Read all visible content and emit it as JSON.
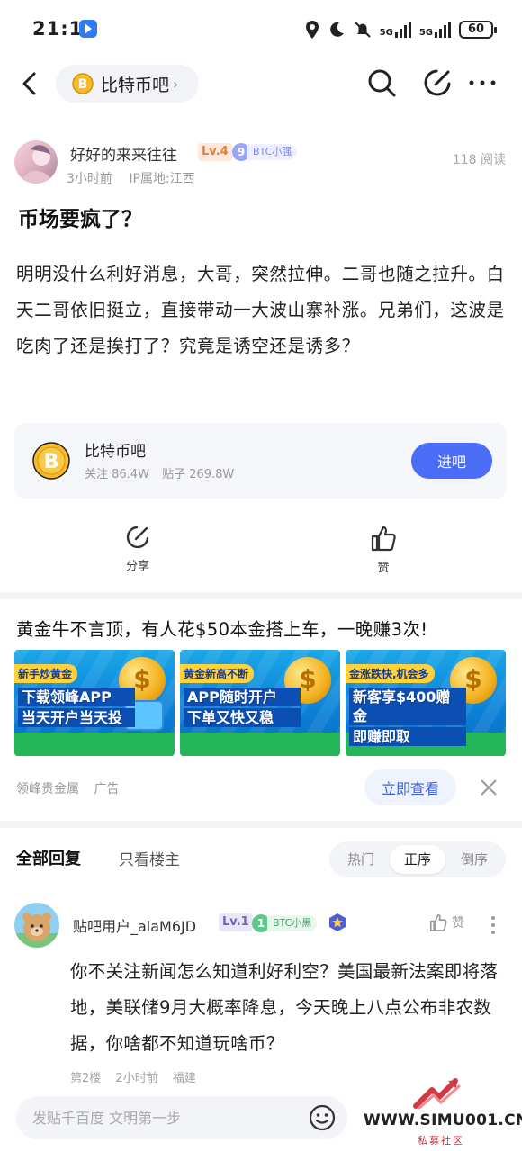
{
  "status_bar": {
    "time": "21:12",
    "network1": "5G",
    "network2": "5G",
    "battery": "60"
  },
  "nav": {
    "forum_name": "比特币吧"
  },
  "post": {
    "author": "好好的来来往往",
    "level": "Lv.4",
    "fan_level": "9",
    "fan_badge": "BTC小强",
    "time_ago": "3小时前",
    "ip_location": "IP属地:江西",
    "reads": "118 阅读",
    "title": "币场要疯了？",
    "body": "明明没什么利好消息，大哥，突然拉伸。二哥也随之拉升。白天二哥依旧挺立，直接带动一大波山寨补涨。兄弟们，这波是吃肉了还是挨打了？究竟是诱空还是诱多？"
  },
  "forum_card": {
    "name": "比特币吧",
    "followers": "关注 86.4W",
    "posts": "贴子 269.8W",
    "enter_label": "进吧"
  },
  "actions": {
    "share_label": "分享",
    "like_label": "赞"
  },
  "ad": {
    "title": "黄金牛不言顶，有人花$50本金搭上车，一晚赚3次!",
    "banners": [
      {
        "tag": "新手炒黄金",
        "line1": "下载领峰APP",
        "line2": "当天开户当天投"
      },
      {
        "tag": "黄金新高不断",
        "line1": "APP随时开户",
        "line2": "下单又快又稳"
      },
      {
        "tag": "金涨跌快,机会多",
        "line1": "新客享$400赠金",
        "line2": "即赚即取"
      }
    ],
    "source": "领峰贵金属",
    "ad_label": "广告",
    "cta": "立即查看"
  },
  "replies": {
    "tab_all": "全部回复",
    "tab_op": "只看楼主",
    "sort_options": [
      "热门",
      "正序",
      "倒序"
    ],
    "active_sort": "正序",
    "items": [
      {
        "user": "贴吧用户_alaM6JD",
        "level": "Lv.1",
        "fan_level": "1",
        "fan_badge": "BTC小黑",
        "like_label": "赞",
        "body": "你不关注新闻怎么知道利好利空？美国最新法案即将落地，美联储9月大概率降息，今天晚上八点公布非农数据，你啥都不知道玩啥币？",
        "floor": "第2楼",
        "time_ago": "2小时前",
        "location": "福建"
      }
    ]
  },
  "composer": {
    "placeholder": "发贴千百度 文明第一步"
  },
  "watermark": {
    "site": "WWW.SIMU001.CN",
    "sub": "私募社区"
  },
  "colors": {
    "accent": "#4a6cf7",
    "coin_gold": "#f2b01e"
  }
}
